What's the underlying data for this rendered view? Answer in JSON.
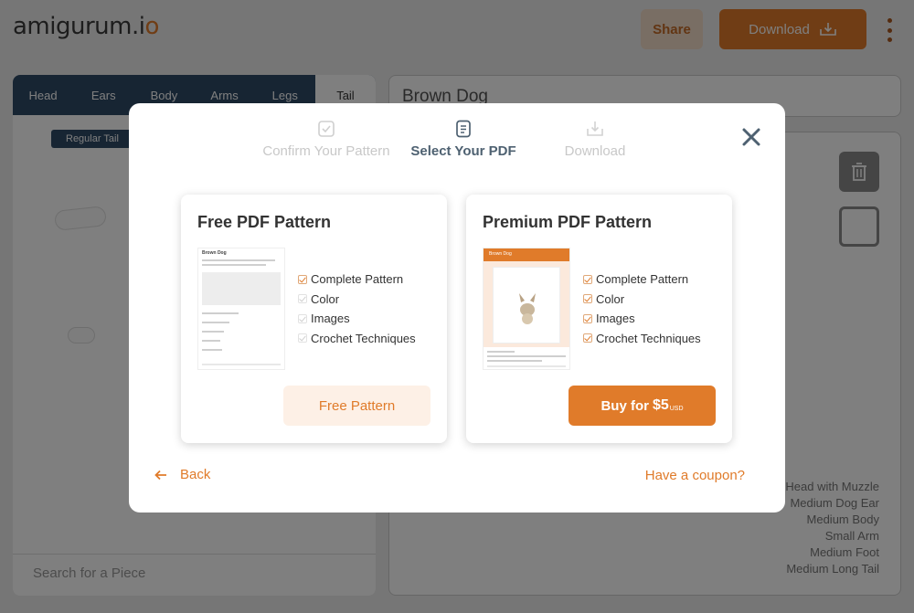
{
  "app": {
    "logo_text": "amigurum.i",
    "logo_accent": "o",
    "share_label": "Share",
    "download_label": "Download"
  },
  "pieces_panel": {
    "tabs": [
      "Head",
      "Ears",
      "Body",
      "Arms",
      "Legs",
      "Tail"
    ],
    "active_tab": "Tail",
    "selected_tag": "Regular Tail",
    "search_placeholder": "Search for a Piece"
  },
  "pattern": {
    "name": "Brown Dog",
    "piece_list": [
      "Head with Muzzle",
      "Medium Dog Ear",
      "Medium Body",
      "Small Arm",
      "Medium Foot",
      "Medium Long Tail"
    ]
  },
  "modal": {
    "steps": [
      {
        "label": "Confirm Your Pattern",
        "icon": "checkbox-icon"
      },
      {
        "label": "Select Your PDF",
        "icon": "document-icon"
      },
      {
        "label": "Download",
        "icon": "download-icon"
      }
    ],
    "active_step": 1,
    "free": {
      "title": "Free PDF Pattern",
      "thumb_title": "Brown Dog",
      "features": [
        "Complete Pattern",
        "Color",
        "Images",
        "Crochet Techniques"
      ],
      "features_included": [
        true,
        false,
        false,
        false
      ],
      "button_label": "Free Pattern"
    },
    "premium": {
      "title": "Premium PDF Pattern",
      "thumb_title": "Brown Dog",
      "features": [
        "Complete Pattern",
        "Color",
        "Images",
        "Crochet Techniques"
      ],
      "features_included": [
        true,
        true,
        true,
        true
      ],
      "button_label": "Buy for",
      "price": "$5",
      "currency": "USD"
    },
    "back_label": "Back",
    "coupon_label": "Have a coupon?"
  },
  "colors": {
    "accent": "#e07b2a",
    "accent_light": "#fdf0e6",
    "nav_dark": "#2f4a66",
    "step_active": "#4e6171"
  }
}
